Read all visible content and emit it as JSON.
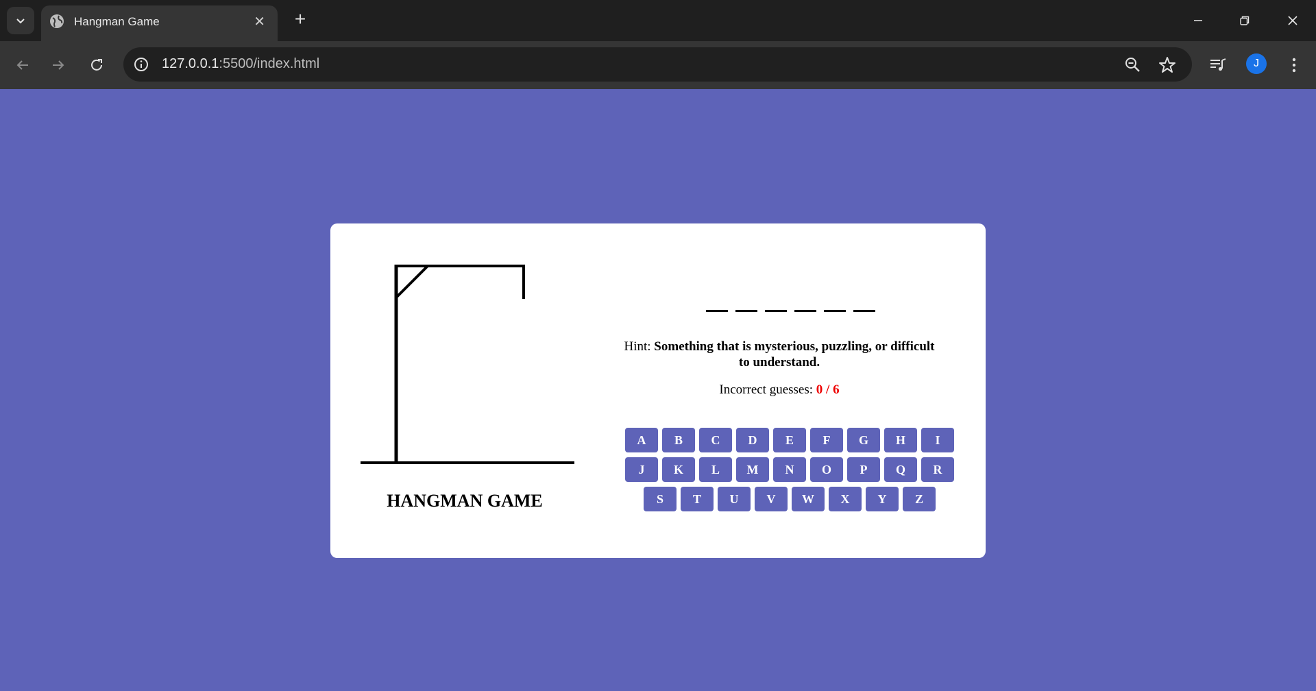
{
  "browser": {
    "tab_title": "Hangman Game",
    "url_host": "127.0.0.1",
    "url_rest": ":5500/index.html",
    "avatar_letter": "J"
  },
  "game": {
    "title": "HANGMAN GAME",
    "hint_label": "Hint:",
    "hint_text": "Something that is mysterious, puzzling, or difficult to understand.",
    "guesses_label": "Incorrect guesses:",
    "guesses_value": "0 / 6",
    "word_blanks": [
      "",
      "",
      "",
      "",
      "",
      ""
    ],
    "keys": [
      "A",
      "B",
      "C",
      "D",
      "E",
      "F",
      "G",
      "H",
      "I",
      "J",
      "K",
      "L",
      "M",
      "N",
      "O",
      "P",
      "Q",
      "R",
      "S",
      "T",
      "U",
      "V",
      "W",
      "X",
      "Y",
      "Z"
    ]
  },
  "colors": {
    "page_bg": "#5e63b8",
    "key_bg": "#5e63b8",
    "guesses_count": "#e00000"
  },
  "icons": [
    "chevron-down-icon",
    "globe-icon",
    "close-icon",
    "plus-icon",
    "minimize-icon",
    "restore-icon",
    "close-window-icon",
    "back-icon",
    "forward-icon",
    "reload-icon",
    "info-icon",
    "zoom-icon",
    "star-icon",
    "media-icon",
    "menu-icon"
  ]
}
